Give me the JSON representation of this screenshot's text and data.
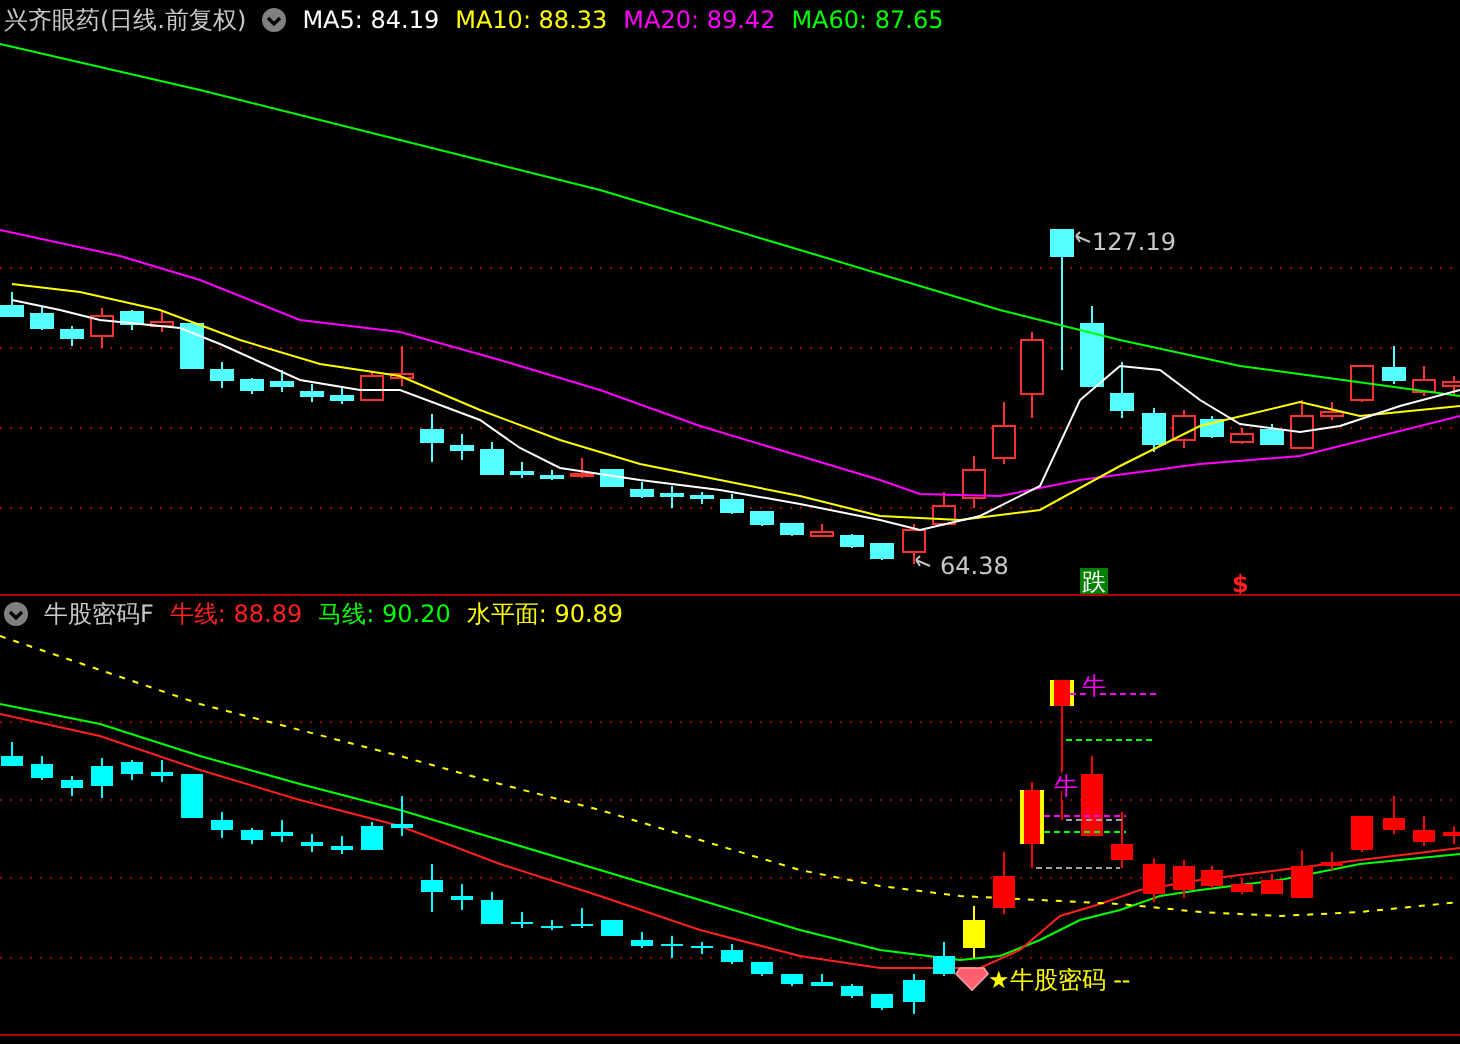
{
  "header": {
    "title": "兴齐眼药(日线.前复权)",
    "indicators": [
      {
        "label": "MA5: 84.19",
        "color": "#ffffff"
      },
      {
        "label": "MA10: 88.33",
        "color": "#ffff00"
      },
      {
        "label": "MA20: 89.42",
        "color": "#ff00ff"
      },
      {
        "label": "MA60: 87.65",
        "color": "#00ff00"
      }
    ]
  },
  "price_panel": {
    "high_label": "127.19",
    "low_label": "64.38",
    "markers": [
      {
        "text": "跌",
        "kind": "badge"
      },
      {
        "text": "$",
        "kind": "symbol"
      }
    ]
  },
  "indicator_header": {
    "title": "牛股密码F",
    "indicators": [
      {
        "label": "牛线: 88.89",
        "color": "#ff2020"
      },
      {
        "label": "马线: 90.20",
        "color": "#00ff00"
      },
      {
        "label": "水平面: 90.89",
        "color": "#ffff00"
      }
    ]
  },
  "indicator_panel": {
    "markers": [
      {
        "text": "牛"
      },
      {
        "text": "牛"
      }
    ],
    "signal_label": "★牛股密码 --"
  }
}
